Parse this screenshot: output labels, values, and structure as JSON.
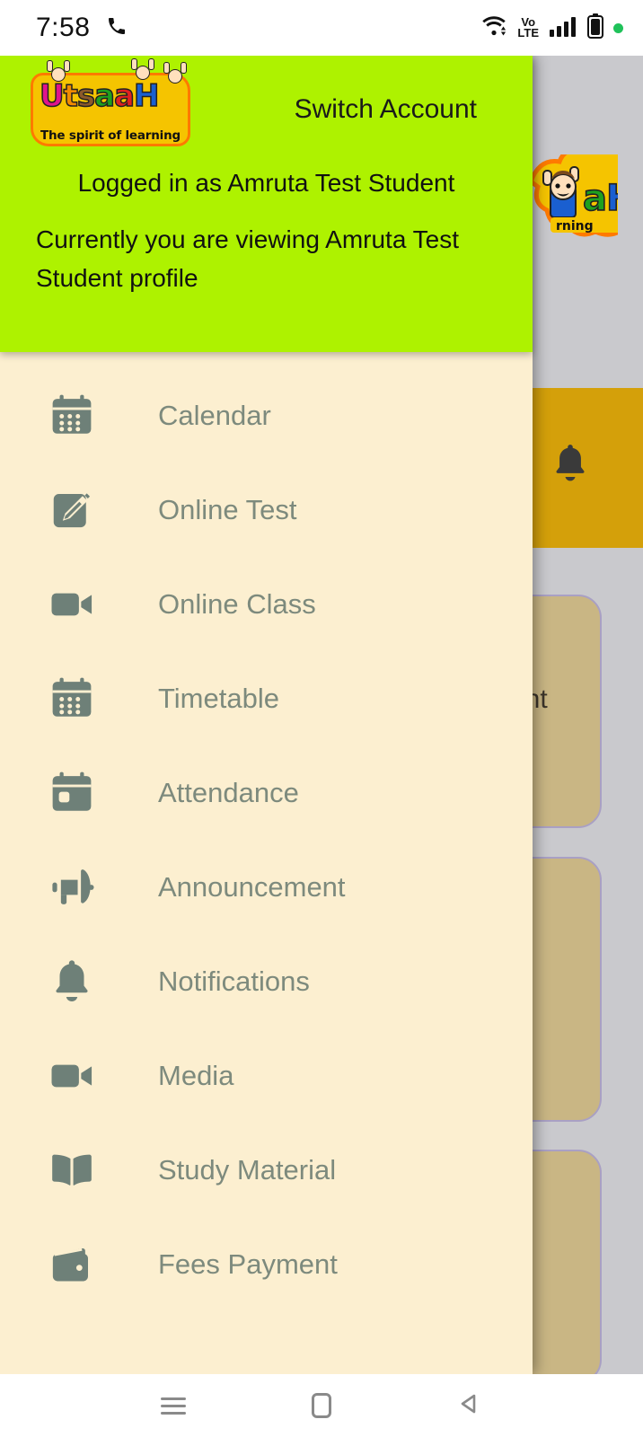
{
  "status_bar": {
    "time": "7:58",
    "icons": [
      "phone-icon",
      "wifi-icon",
      "volte-icon",
      "signal-icon",
      "battery-icon",
      "green-dot-indicator"
    ],
    "volte_top": "Vo",
    "volte_bottom": "LTE"
  },
  "drawer": {
    "logo": {
      "word_letters": [
        "U",
        "t",
        "s",
        "a",
        "a",
        "H"
      ],
      "tagline": "The spirit of learning",
      "colors": {
        "plate": "#F5C400",
        "outline": "#FF7A00",
        "U": "#E0148C",
        "t": "#F08A00",
        "s": "#8B5A2B",
        "a1": "#1EA01E",
        "a2": "#E02020",
        "H": "#1A5FD0"
      }
    },
    "switch_account_label": "Switch Account",
    "logged_in_text": "Logged in as Amruta Test Student",
    "viewing_text": "Currently you are viewing Amruta Test Student profile",
    "header_bg": "#AEF200",
    "body_bg": "#FCEFD0",
    "menu": [
      {
        "label": "Calendar",
        "icon": "calendar-icon"
      },
      {
        "label": "Online Test",
        "icon": "note-pencil-icon"
      },
      {
        "label": "Online Class",
        "icon": "video-camera-icon"
      },
      {
        "label": "Timetable",
        "icon": "calendar-icon"
      },
      {
        "label": "Attendance",
        "icon": "calendar-check-icon"
      },
      {
        "label": "Announcement",
        "icon": "megaphone-icon"
      },
      {
        "label": "Notifications",
        "icon": "bell-icon"
      },
      {
        "label": "Media",
        "icon": "video-camera-icon"
      },
      {
        "label": "Study Material",
        "icon": "open-book-icon"
      },
      {
        "label": "Fees Payment",
        "icon": "wallet-icon"
      }
    ],
    "icon_color": "#6E8078",
    "label_color": "#7D8A7D"
  },
  "background_app": {
    "page_bg": "#C9C9CD",
    "gold_bar_color": "#D4A00A",
    "gold_bar_icon": "bell-icon",
    "card_color": "#C9B684",
    "card_border": "#A9A0C4",
    "card_partial_text": "ent"
  },
  "nav_bar": {
    "buttons": [
      {
        "name": "recent-apps-button",
        "icon": "hamburger-icon"
      },
      {
        "name": "home-button",
        "icon": "home-square-icon"
      },
      {
        "name": "back-button",
        "icon": "back-triangle-icon"
      }
    ]
  }
}
